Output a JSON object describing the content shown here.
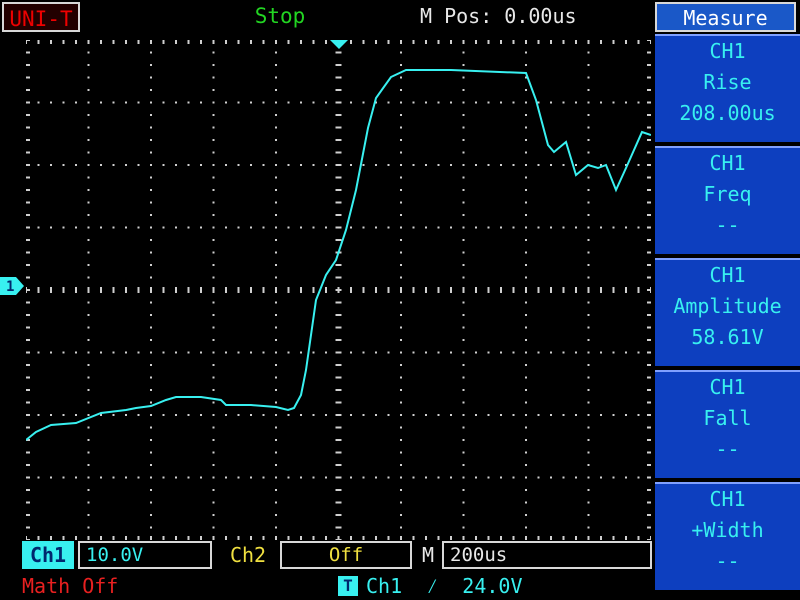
{
  "header": {
    "brand": "UNI-T",
    "status": "Stop",
    "m_pos": "M Pos: 0.00us"
  },
  "menu": {
    "title": "Measure",
    "items": [
      {
        "line1": "CH1",
        "line2": "Rise",
        "line3": "208.00us"
      },
      {
        "line1": "CH1",
        "line2": "Freq",
        "line3": "--"
      },
      {
        "line1": "CH1",
        "line2": "Amplitude",
        "line3": "58.61V"
      },
      {
        "line1": "CH1",
        "line2": "Fall",
        "line3": "--"
      },
      {
        "line1": "CH1",
        "line2": "+Width",
        "line3": "--"
      }
    ]
  },
  "bottom": {
    "ch1_label": "Ch1",
    "ch1_scale": "10.0V",
    "ch2_label": "Ch2",
    "ch2_state": "Off",
    "m_label": "M",
    "timebase": "200us",
    "math": "Math Off",
    "trigger_badge": "T",
    "trigger_text": "Ch1  ⁄  24.0V"
  },
  "markers": {
    "ch1_marker": "1"
  },
  "colors": {
    "trace": "#38f0f0",
    "grid": "#d0d0d0",
    "menu_bg": "#0d3fbf",
    "status": "#22d522"
  }
}
